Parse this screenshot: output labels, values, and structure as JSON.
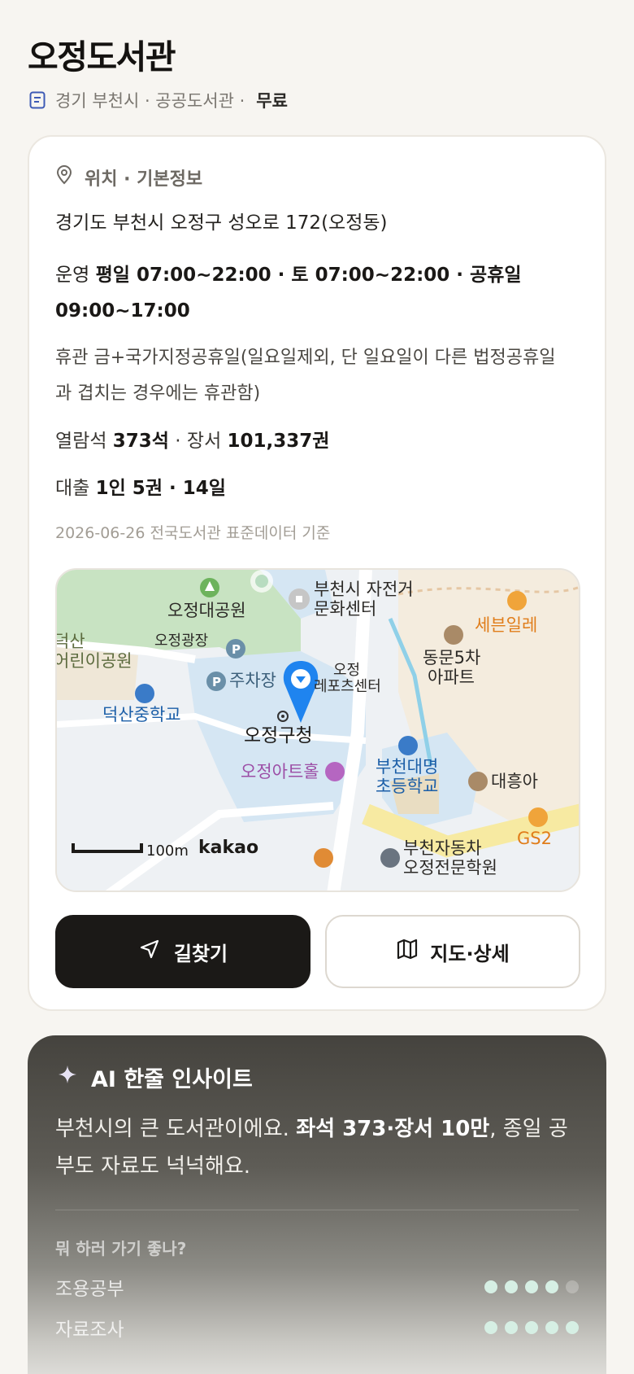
{
  "header": {
    "title": "오정도서관",
    "subtitle": "경기 부천시 · 공공도서관 ·",
    "fee": "무료"
  },
  "info": {
    "section_title": "위치 · 기본정보",
    "address": "경기도 부천시 오정구 성오로 172(오정동)",
    "hours_label": "운영",
    "hours_value": "평일 07:00~22:00 · 토 07:00~22:00 · 공휴일 09:00~17:00",
    "closed_text": "휴관 금+국가지정공휴일(일요일제외, 단 일요일이 다른 법정공휴일과 겹치는 경우에는 휴관함)",
    "seats_label": "열람석",
    "seats_value": "373석",
    "books_label": "· 장서",
    "books_value": "101,337권",
    "loan_label": "대출",
    "loan_value": "1인 5권 · 14일",
    "basis": "2026-06-26 전국도서관 표준데이터 기준"
  },
  "map": {
    "labels": {
      "park": "오정대공원",
      "bike": "부천시 자전거",
      "bike2": "문화센터",
      "plaza": "오정광장",
      "kidspark1": "덕산",
      "kidspark2": "어린이공원",
      "parking": "주차장",
      "sports1": "오정",
      "sports2": "레포츠센터",
      "middle": "덕산중학교",
      "office": "오정구청",
      "arthall": "오정아트홀",
      "apt1": "동문5차",
      "apt2": "아파트",
      "seven": "세븐일레",
      "elem1": "부천대명",
      "elem2": "초등학교",
      "daeheung": "대흥아",
      "gs": "GS2",
      "car1": "부천자동차",
      "car2": "오정전문학원",
      "scale": "100m",
      "brand": "kakao"
    },
    "colors": {
      "park": "#c8e3c2",
      "water": "#d5e6f3",
      "road": "#ffffff",
      "pin": "#1f84ef",
      "purple": "#9c4ea6",
      "blue": "#1c5fa8"
    }
  },
  "actions": {
    "route_label": "길찾기",
    "map_label": "지도·상세"
  },
  "ai": {
    "title": "AI 한줄 인사이트",
    "text_part1": "부천시의 큰 도서관이에요.",
    "text_bold": "좌석 373·장서 10만",
    "text_part2": ", 종일 공부도 자료도 넉넉해요.",
    "question": "뭐 하러 가기 좋나?",
    "ratings": [
      {
        "label": "조용공부",
        "score": 4
      },
      {
        "label": "자료조사",
        "score": 5
      }
    ]
  }
}
